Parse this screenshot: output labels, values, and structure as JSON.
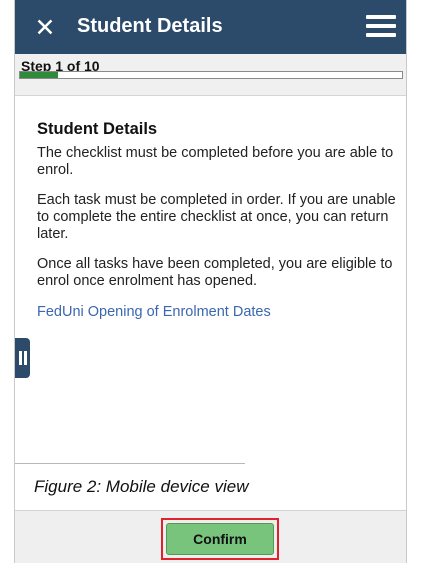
{
  "header": {
    "close_icon_char": "✕",
    "title": "Student Details",
    "menu_icon": "hamburger-menu-icon",
    "background_color": "#2c4b6b"
  },
  "progress": {
    "step_label": "Step 1 of 10",
    "current_step": 1,
    "total_steps": 10,
    "fill_fraction": 0.1,
    "fill_color": "#2e8b3a"
  },
  "content": {
    "heading": "Student Details",
    "paragraphs": [
      "The checklist must be completed before you are able to enrol.",
      "Each task must be completed in order.  If you are unable to complete the entire checklist at once, you can return later.",
      "Once all tasks have been completed, you are eligible to enrol once enrolment has opened."
    ],
    "link_text": "FedUni Opening of Enrolment Dates"
  },
  "caption": "Figure 2: Mobile device view",
  "footer": {
    "confirm_label": "Confirm",
    "confirm_color": "#78c47d",
    "highlight_color": "#e0232b"
  }
}
